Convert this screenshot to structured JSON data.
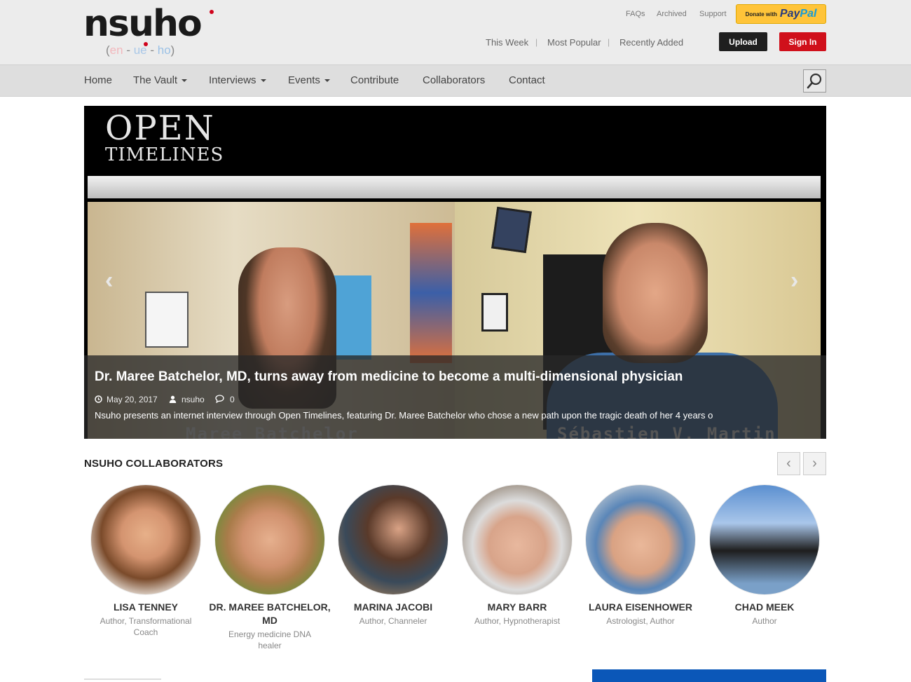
{
  "brand": {
    "logo_text": "nsuho",
    "pronounce_open": "(",
    "pronounce_en": "en",
    "pronounce_dash1": " - ",
    "pronounce_ue": "ue",
    "pronounce_dash2": " - ",
    "pronounce_ho": "ho",
    "pronounce_close": ")"
  },
  "util_links": [
    "FAQs",
    "Archived",
    "Support"
  ],
  "paypal": {
    "prefix": "Donate with",
    "brand_a": "Pay",
    "brand_b": "Pal"
  },
  "sub_links": [
    "This Week",
    "Most Popular",
    "Recently Added"
  ],
  "separator": "|",
  "auth": {
    "upload": "Upload",
    "signin": "Sign In"
  },
  "nav": [
    "Home",
    "The Vault",
    "Interviews",
    "Events",
    "Contribute",
    "Collaborators",
    "Contact"
  ],
  "hero": {
    "brand_line1": "OPEN",
    "brand_line2": "TIMELINES",
    "prev_arrow": "‹",
    "next_arrow": "›",
    "title": "Dr. Maree Batchelor, MD, turns away from medicine to become a multi-dimensional physician",
    "date": "May 20, 2017",
    "author": "nsuho",
    "comments": "0",
    "excerpt": "Nsuho presents an internet interview through Open Timelines, featuring Dr. Maree Batchelor who chose a new path upon the tragic death of her 4 years o",
    "watermark_left": "Maree Batchelor",
    "watermark_right": "Sébastien V. Martin"
  },
  "collaborators": {
    "heading": "NSUHO COLLABORATORS",
    "prev": "‹",
    "next": "›",
    "people": [
      {
        "name": "LISA TENNEY",
        "role": "Author, Transformational Coach"
      },
      {
        "name": "DR. MAREE BATCHELOR, MD",
        "role": "Energy medicine DNA healer"
      },
      {
        "name": "MARINA JACOBI",
        "role": "Author, Channeler"
      },
      {
        "name": "MARY BARR",
        "role": "Author, Hypnotherapist"
      },
      {
        "name": "LAURA EISENHOWER",
        "role": "Astrologist, Author"
      },
      {
        "name": "CHAD MEEK",
        "role": "Author"
      }
    ]
  },
  "colors": {
    "accent_red": "#d0101b",
    "paypal_yellow": "#ffc439",
    "nav_bg": "#dedede"
  }
}
